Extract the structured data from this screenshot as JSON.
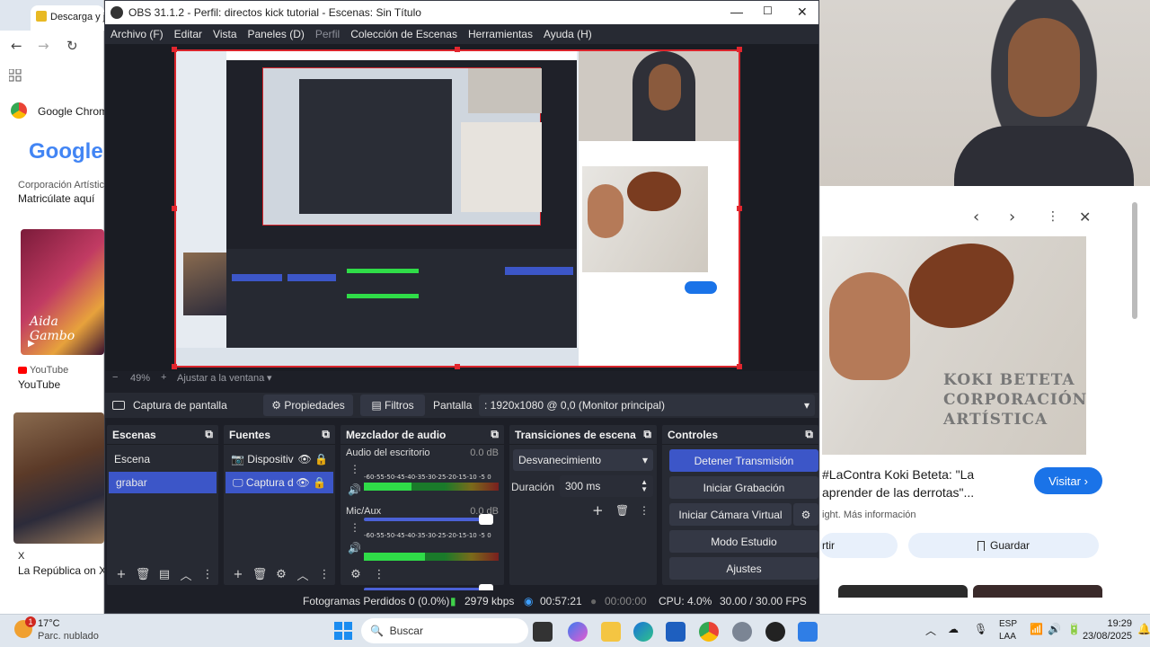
{
  "bg_browser": {
    "tab_title": "Descarga y j",
    "items": [
      {
        "label": "Google Chrome"
      },
      {
        "label": "Google"
      },
      {
        "label": "Corporación Artística"
      },
      {
        "label": "Matricúlate aquí"
      },
      {
        "label": "YouTube"
      },
      {
        "label": "YouTube"
      },
      {
        "label": "X"
      },
      {
        "label": "La República on X"
      }
    ],
    "thumb_caption": "Aida Gambo"
  },
  "obs": {
    "window_title": "OBS 31.1.2 - Perfil: directos kick tutorial - Escenas: Sin Título",
    "menu": [
      "Archivo (F)",
      "Editar",
      "Vista",
      "Paneles (D)",
      "Perfil",
      "Colección de Escenas",
      "Herramientas",
      "Ayuda (H)"
    ],
    "zoom": "49%",
    "fit_label": "Ajustar a la ventana",
    "source_bar": {
      "source_name": "Captura de pantalla",
      "properties": "Propiedades",
      "filters": "Filtros",
      "display_label": "Pantalla",
      "display_value": ": 1920x1080 @ 0,0 (Monitor principal)"
    },
    "scenes": {
      "title": "Escenas",
      "items": [
        {
          "label": "Escena",
          "selected": false
        },
        {
          "label": "grabar",
          "selected": true
        }
      ]
    },
    "sources": {
      "title": "Fuentes",
      "items": [
        {
          "label": "Dispositiv",
          "icon": "camera-icon",
          "selected": false
        },
        {
          "label": "Captura d",
          "icon": "monitor-icon",
          "selected": true
        }
      ]
    },
    "mixer": {
      "title": "Mezclador de audio",
      "channels": [
        {
          "name": "Audio del escritorio",
          "db": "0.0 dB",
          "level": 0.35,
          "volume": 1.0
        },
        {
          "name": "Mic/Aux",
          "db": "0.0 dB",
          "level": 0.45,
          "volume": 1.0
        }
      ],
      "scale": "-60-55-50-45-40-35-30-25-20-15-10 -5  0"
    },
    "transitions": {
      "title": "Transiciones de escena",
      "selected": "Desvanecimiento",
      "duration_label": "Duración",
      "duration_value": "300 ms"
    },
    "controls": {
      "title": "Controles",
      "buttons": [
        "Detener Transmisión",
        "Iniciar Grabación",
        "Iniciar Cámara Virtual",
        "Modo Estudio",
        "Ajustes"
      ]
    },
    "status": {
      "dropped": "Fotogramas Perdidos 0 (0.0%)",
      "bitrate": "2979 kbps",
      "stream_time": "00:57:21",
      "rec_time": "00:00:00",
      "cpu": "CPU: 4.0%",
      "fps": "30.00 / 30.00 FPS"
    }
  },
  "right_browser": {
    "caption": "#LaContra Koki Beteta: \"La aprender de las derrotas\"...",
    "caption_line1": "#LaContra Koki Beteta: \"La",
    "caption_line2": "aprender de las derrotas\"...",
    "visit": "Visitar",
    "more_info": "ight. Más información",
    "save": "Guardar",
    "share_partial": "rtir",
    "sign_line1": "KOKI BETETA",
    "sign_line2": "CORPORACIÓN",
    "sign_line3": "ARTÍSTICA"
  },
  "taskbar": {
    "weather_temp": "17°C",
    "weather_desc": "Parc. nublado",
    "weather_badge": "1",
    "search": "Buscar",
    "lang1": "ESP",
    "lang2": "LAA",
    "time": "19:29",
    "date": "23/08/2025"
  },
  "colors": {
    "obs_bg": "#1d1f27",
    "obs_panel": "#272a33",
    "accent": "#3c56c8",
    "recording_border": "#d9252c"
  }
}
